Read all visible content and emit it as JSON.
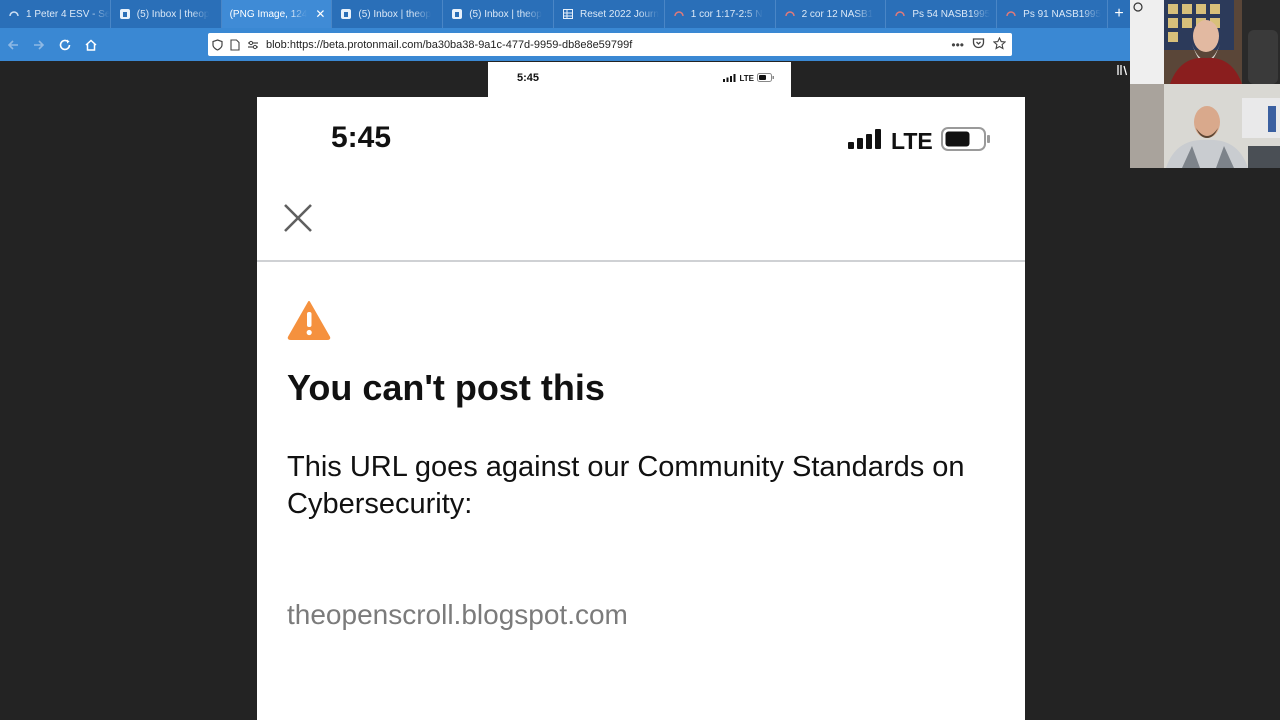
{
  "browser": {
    "tabs": [
      {
        "label": "1 Peter 4 ESV - Se",
        "icon": "loading-icon",
        "active": false
      },
      {
        "label": "(5) Inbox | theop",
        "icon": "mail-icon",
        "active": false
      },
      {
        "label": "(PNG Image, 124",
        "icon": "none",
        "active": true
      },
      {
        "label": "(5) Inbox | theop",
        "icon": "mail-icon",
        "active": false
      },
      {
        "label": "(5) Inbox | theop",
        "icon": "mail-icon",
        "active": false
      },
      {
        "label": "Reset 2022 Journ",
        "icon": "sheet-icon",
        "active": false
      },
      {
        "label": "1 cor 1:17-2:5 N",
        "icon": "loading-icon",
        "active": false
      },
      {
        "label": "2 cor 12 NASB1",
        "icon": "loading-icon",
        "active": false
      },
      {
        "label": "Ps 54 NASB1995",
        "icon": "loading-icon",
        "active": false
      },
      {
        "label": "Ps 91 NASB1995",
        "icon": "loading-icon",
        "active": false
      }
    ],
    "close_tab_glyph": "✕",
    "new_tab_glyph": "+",
    "url": "blob:https://beta.protonmail.com/ba30ba38-9a1c-477d-9959-db8e8e59799f",
    "more_glyph": "•••",
    "colors": {
      "tabstrip": "#2a6fb8",
      "navbar": "#3a88d3",
      "active_tab": "#3f8bd6"
    }
  },
  "phone_mini_status": {
    "time": "5:45",
    "network": "LTE"
  },
  "status_bar": {
    "time": "5:45",
    "network": "LTE"
  },
  "dialog": {
    "headline": "You can't post this",
    "body": "This URL goes against our Community Standards on Cybersecurity:",
    "blocked_url": "theopenscroll.blogspot.com",
    "warning_color": "#f5913e"
  }
}
